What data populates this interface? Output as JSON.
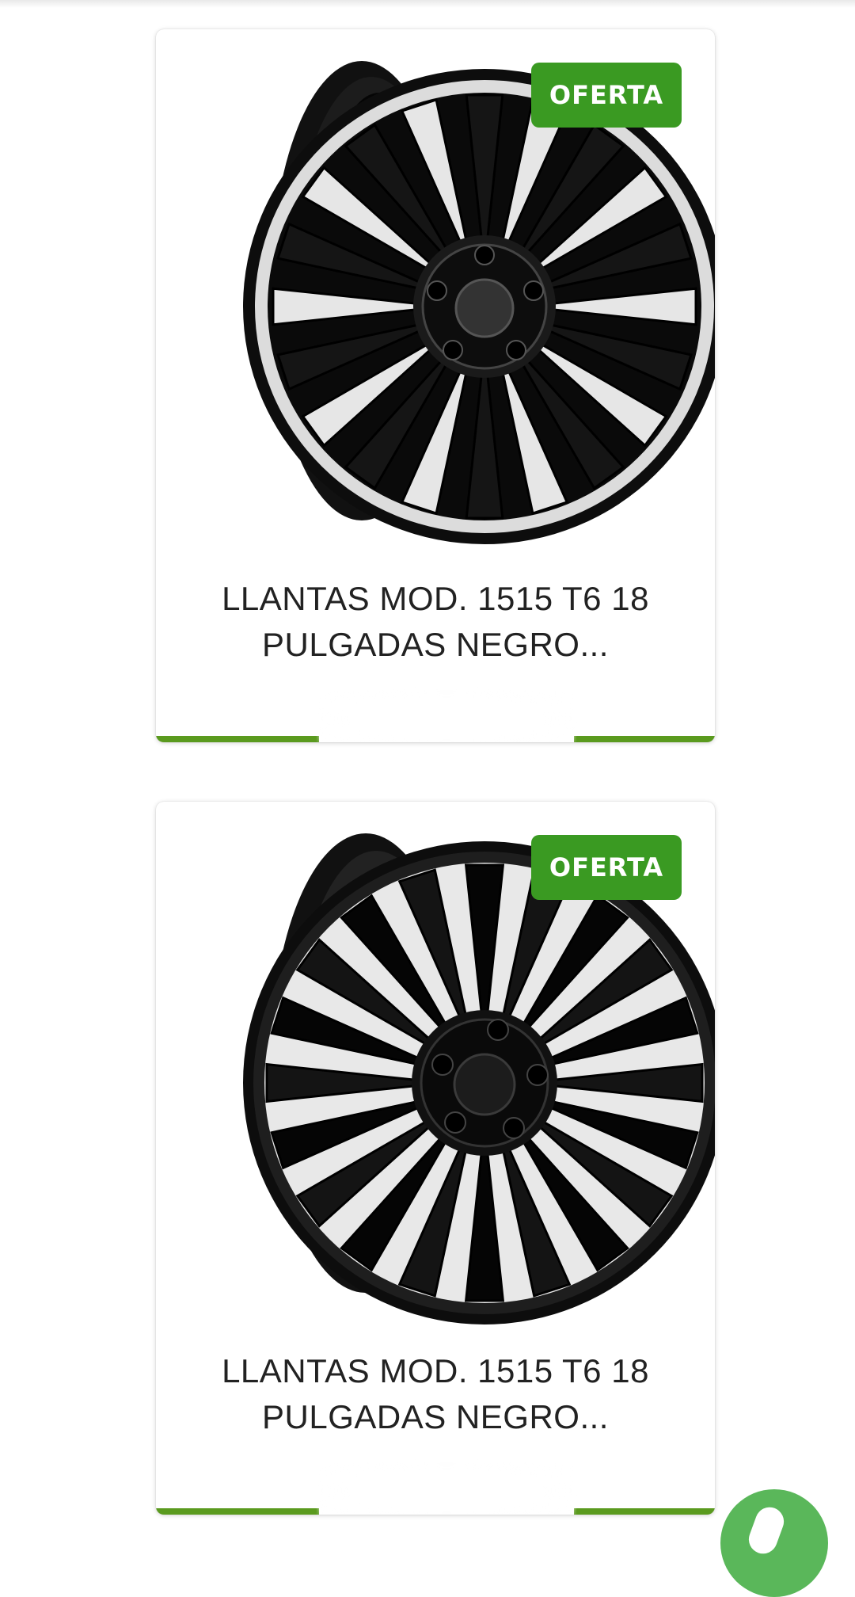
{
  "colors": {
    "badge": "#3a9a22",
    "accent_bar": "#5a9a1e",
    "fab": "#5ab75a",
    "title_text": "#222222"
  },
  "products": [
    {
      "badge": "OFERTA",
      "title_line1": "LLANTAS MOD. 1515 T6 18",
      "title_line2": "PULGADAS NEGRO...",
      "image": "wheel-black-machined-face-icon"
    },
    {
      "badge": "OFERTA",
      "title_line1": "LLANTAS MOD. 1515 T6 18",
      "title_line2": "PULGADAS NEGRO...",
      "image": "wheel-gloss-black-icon"
    }
  ],
  "floating_button": {
    "icon": "whatsapp-icon"
  }
}
